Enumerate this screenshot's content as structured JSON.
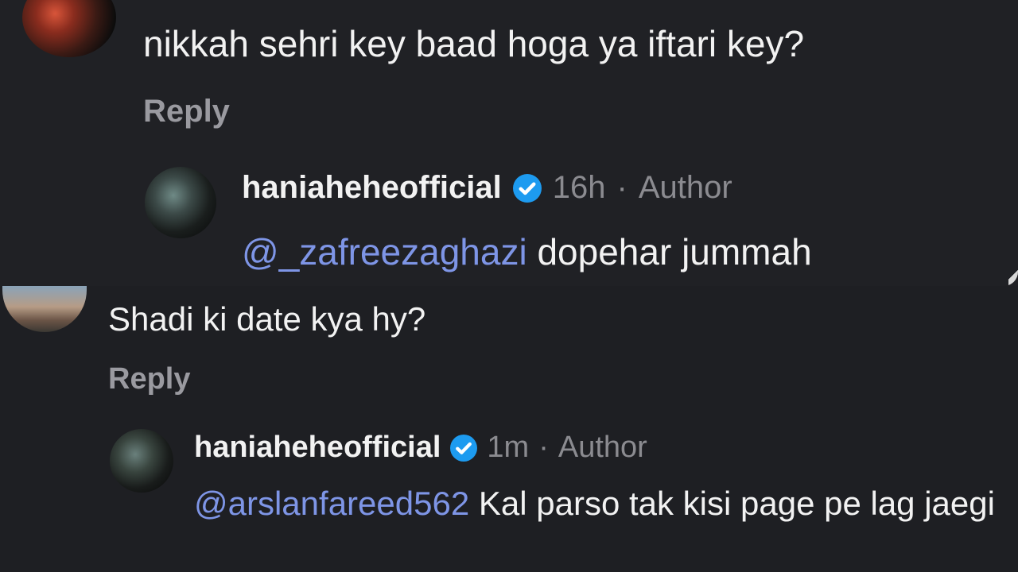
{
  "top_comment": {
    "text": "nikkah sehri key baad hoga ya iftari key?",
    "reply_label": "Reply",
    "reply": {
      "username": "haniaheheofficial",
      "time": "16h",
      "separator": "·",
      "role": "Author",
      "mention": "@_zafreezaghazi",
      "body": "dopehar jummah"
    }
  },
  "bottom_comment": {
    "text": "Shadi ki date kya hy?",
    "reply_label": "Reply",
    "reply": {
      "username": "haniaheheofficial",
      "time": "1m",
      "separator": "·",
      "role": "Author",
      "mention": "@arslanfareed562",
      "body": "Kal parso tak kisi page pe lag jaegi"
    }
  },
  "icons": {
    "verified": "verified-badge-icon"
  },
  "colors": {
    "background": "#202024",
    "text": "#f2f2f2",
    "muted": "#8b8b90",
    "mention": "#7e95e6",
    "verified": "#1d9bf0"
  }
}
